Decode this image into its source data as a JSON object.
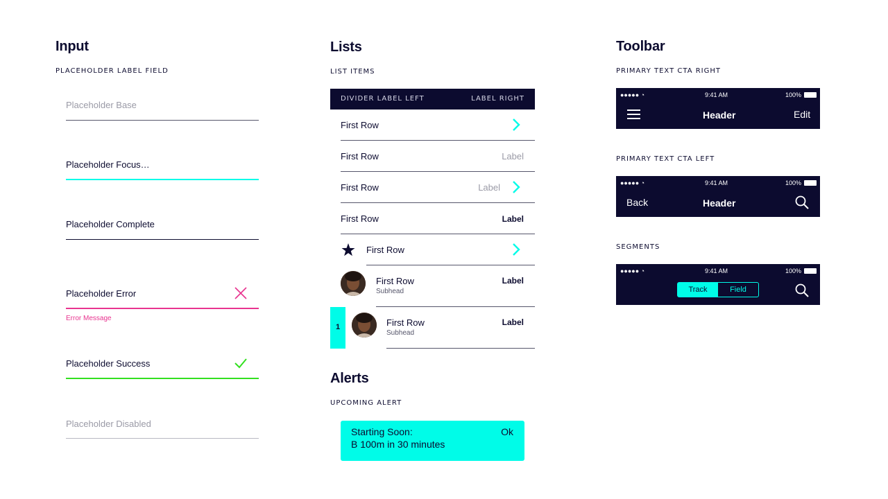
{
  "input": {
    "title": "Input",
    "caption": "PLACEHOLDER LABEL FIELD",
    "base": "Placeholder Base",
    "focus": "Placeholder Focus…",
    "complete": "Placeholder Complete",
    "error": "Placeholder Error",
    "error_message": "Error Message",
    "success": "Placeholder Success",
    "disabled": "Placeholder Disabled"
  },
  "lists": {
    "title": "Lists",
    "caption": "LIST ITEMS",
    "divider_left": "DIVIDER LABEL LEFT",
    "divider_right": "LABEL RIGHT",
    "rows": [
      {
        "title": "First Row"
      },
      {
        "title": "First Row",
        "label": "Label"
      },
      {
        "title": "First Row",
        "label": "Label"
      },
      {
        "title": "First Row",
        "label": "Label"
      },
      {
        "title": "First Row"
      },
      {
        "title": "First Row",
        "subhead": "Subhead",
        "label": "Label"
      },
      {
        "title": "First Row",
        "subhead": "Subhead",
        "label": "Label",
        "rank": "1"
      }
    ]
  },
  "alerts": {
    "title": "Alerts",
    "caption": "UPCOMING ALERT",
    "line1": "Starting Soon:",
    "line2": "B 100m in 30 minutes",
    "action": "Ok"
  },
  "toolbar": {
    "title": "Toolbar",
    "caption_right": "PRIMARY TEXT CTA RIGHT",
    "caption_left": "PRIMARY TEXT CTA LEFT",
    "caption_segments": "SEGMENTS",
    "time": "9:41 AM",
    "battery": "100%",
    "header": "Header",
    "edit": "Edit",
    "back": "Back",
    "seg_track": "Track",
    "seg_field": "Field"
  },
  "colors": {
    "navy": "#0c0b2f",
    "accent": "#00fce8",
    "error": "#e8338f",
    "success": "#32e01f"
  },
  "icons": [
    "chevron-right-icon",
    "star-icon",
    "close-icon",
    "check-icon",
    "menu-icon",
    "search-icon",
    "wifi-icon",
    "battery-icon",
    "signal-icon"
  ]
}
